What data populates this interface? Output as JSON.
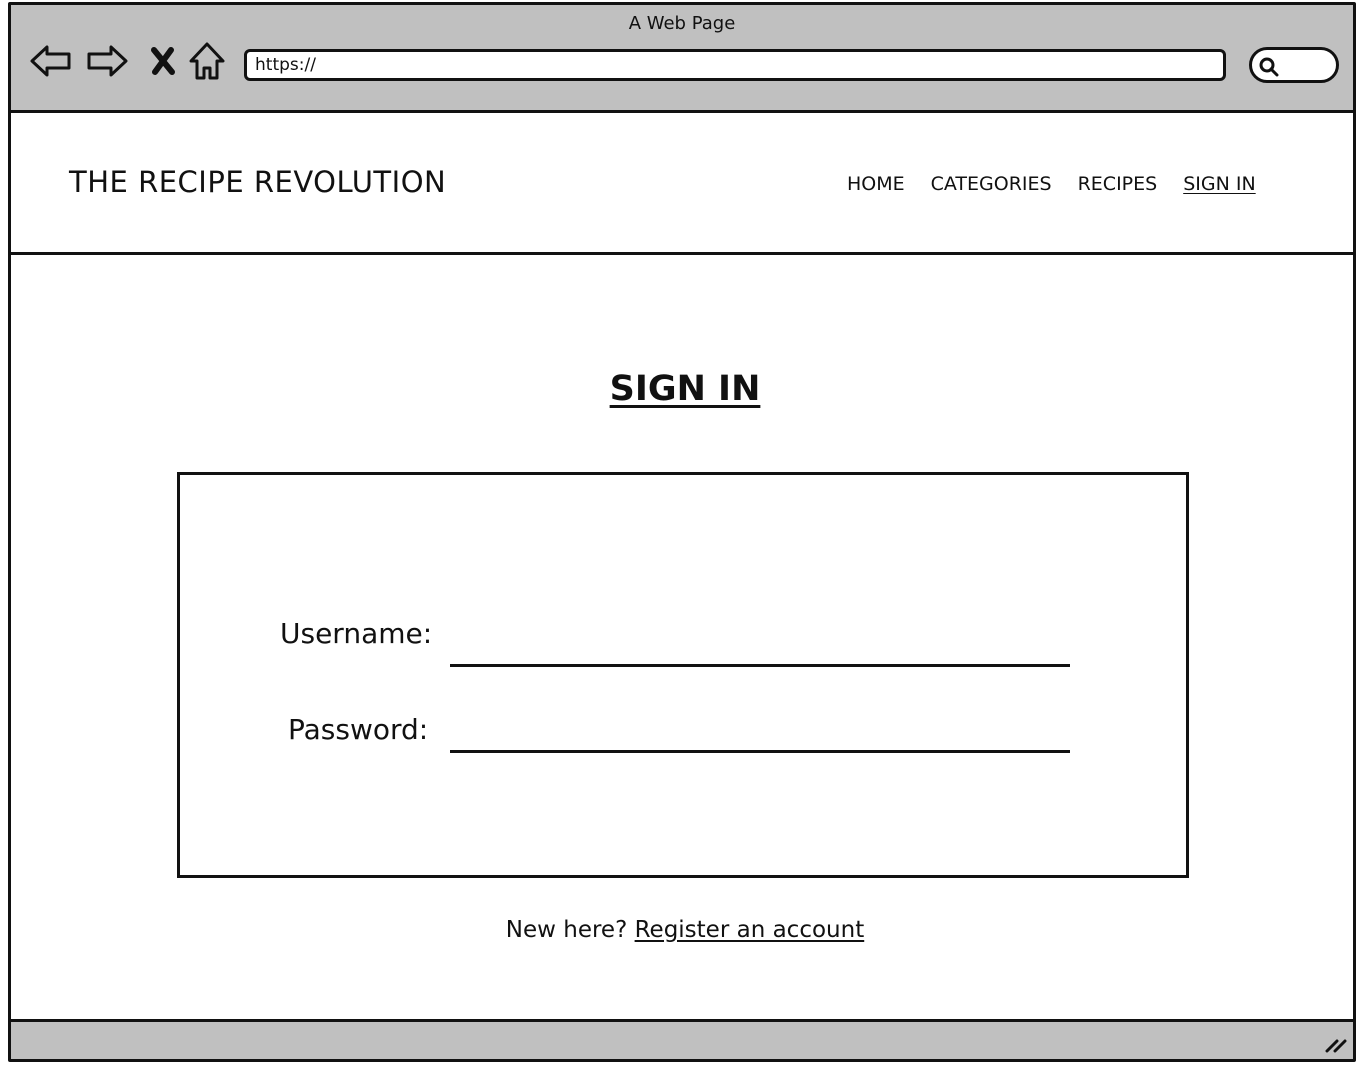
{
  "browser": {
    "window_title": "A Web Page",
    "url": "https://",
    "icons": {
      "back": "back-arrow-icon",
      "forward": "forward-arrow-icon",
      "stop": "close-icon",
      "home": "home-icon",
      "search": "search-icon",
      "resize": "resize-handle-icon"
    }
  },
  "header": {
    "logo": "THE RECIPE REVOLUTION",
    "nav": [
      {
        "label": "HOME"
      },
      {
        "label": "CATEGORIES"
      },
      {
        "label": "RECIPES"
      },
      {
        "label": "SIGN IN",
        "active": true
      }
    ]
  },
  "main": {
    "heading": "SIGN IN",
    "form": {
      "username_label": "Username:",
      "username_value": "",
      "password_label": "Password:",
      "password_value": ""
    },
    "register": {
      "prompt": "New here?",
      "link": "Register an account"
    }
  },
  "colors": {
    "chrome": "#c0c0c0",
    "stroke": "#111111",
    "background": "#ffffff"
  }
}
